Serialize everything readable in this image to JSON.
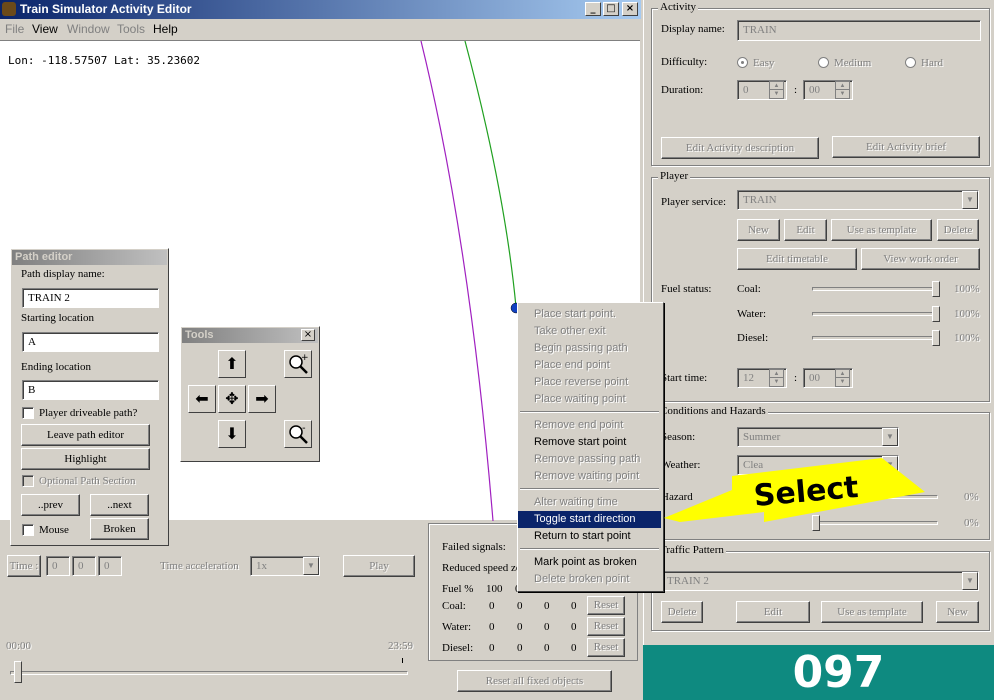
{
  "main_window": {
    "title": "Train Simulator Activity Editor",
    "menu": [
      "File",
      "View",
      "Window",
      "Tools",
      "Help"
    ],
    "coords": "Lon: -118.57507 Lat: 35.23602",
    "controls": [
      "_",
      "□",
      "×"
    ]
  },
  "path_editor": {
    "title": "Path editor",
    "display_name_label": "Path display name:",
    "display_name_value": "TRAIN 2",
    "starting_location_label": "Starting location",
    "starting_location_value": "A",
    "ending_location_label": "Ending location",
    "ending_location_value": "B",
    "player_driveable_label": "Player driveable path?",
    "leave_button": "Leave path editor",
    "highlight_button": "Highlight",
    "optional_section_label": "Optional Path Section",
    "prev_button": "..prev",
    "next_button": "..next",
    "mouse_label": "Mouse",
    "broken_button": "Broken"
  },
  "tools_window": {
    "title": "Tools",
    "close": "×"
  },
  "context_menu": {
    "items": [
      {
        "label": "Place start point.",
        "enabled": false
      },
      {
        "label": "Take other exit",
        "enabled": false
      },
      {
        "label": "Begin passing path",
        "enabled": false
      },
      {
        "label": "Place end point",
        "enabled": false
      },
      {
        "label": "Place reverse point",
        "enabled": false
      },
      {
        "label": "Place waiting point",
        "enabled": false
      },
      {
        "label": "Remove end point",
        "enabled": false
      },
      {
        "label": "Remove start point",
        "enabled": true
      },
      {
        "label": "Remove passing path",
        "enabled": false
      },
      {
        "label": "Remove waiting point",
        "enabled": false
      },
      {
        "label": "Alter waiting time",
        "enabled": false
      },
      {
        "label": "Toggle start direction",
        "enabled": true,
        "selected": true
      },
      {
        "label": "Return to start point",
        "enabled": true
      },
      {
        "label": "Mark point as broken",
        "enabled": true
      },
      {
        "label": "Delete broken point",
        "enabled": false
      }
    ]
  },
  "callout": {
    "text": "Select",
    "color": "#ffff00"
  },
  "bottom_panel": {
    "time_label": "Time :",
    "time_fields": [
      "0",
      "0",
      "0"
    ],
    "time_accel_label": "Time acceleration",
    "time_accel_value": "1x",
    "play_button": "Play",
    "slider_start": "00:00",
    "slider_end": "23:59"
  },
  "stats_panel": {
    "failed_signals": "Failed signals:",
    "reduced_speed": "Reduced speed zo",
    "fuel_label": "Fuel %",
    "fuel_header": [
      "100",
      "0",
      "0",
      "0"
    ],
    "rows": [
      {
        "label": "Coal:",
        "values": [
          "0",
          "0",
          "0",
          "0"
        ],
        "button": "Reset"
      },
      {
        "label": "Water:",
        "values": [
          "0",
          "0",
          "0",
          "0"
        ],
        "button": "Reset"
      },
      {
        "label": "Diesel:",
        "values": [
          "0",
          "0",
          "0",
          "0"
        ],
        "button": "Reset"
      }
    ],
    "reset_all": "Reset all fixed objects"
  },
  "activity": {
    "group": "Activity",
    "display_name_label": "Display name:",
    "display_name_value": "TRAIN",
    "difficulty_label": "Difficulty:",
    "difficulty_options": [
      "Easy",
      "Medium",
      "Hard"
    ],
    "duration_label": "Duration:",
    "duration_hours": "0",
    "duration_minutes": "00",
    "edit_description": "Edit Activity description",
    "edit_brief": "Edit Activity brief"
  },
  "player": {
    "group": "Player",
    "service_label": "Player service:",
    "service_value": "TRAIN",
    "buttons": [
      "New",
      "Edit",
      "Use as template",
      "Delete"
    ],
    "edit_timetable": "Edit timetable",
    "view_work_order": "View work order",
    "fuel_status_label": "Fuel status:",
    "fuel": [
      {
        "label": "Coal:",
        "value": "100%",
        "level": 1.0
      },
      {
        "label": "Water:",
        "value": "100%",
        "level": 1.0
      },
      {
        "label": "Diesel:",
        "value": "100%",
        "level": 1.0
      }
    ],
    "start_time_label": "Start time:",
    "start_hours": "12",
    "start_minutes": "00"
  },
  "conditions": {
    "group": "Conditions and Hazards",
    "season_label": "Season:",
    "season_value": "Summer",
    "weather_label": "Weather:",
    "weather_value": "Clea",
    "hazard_label": "Hazard",
    "hazard_1": "0%",
    "hazard_2": "0%"
  },
  "traffic": {
    "group": "Traffic Pattern",
    "value": "TRAIN 2",
    "buttons": [
      "Delete",
      "Edit",
      "Use as template",
      "New"
    ]
  },
  "badge": {
    "text": "097",
    "color": "#0e8a80"
  }
}
